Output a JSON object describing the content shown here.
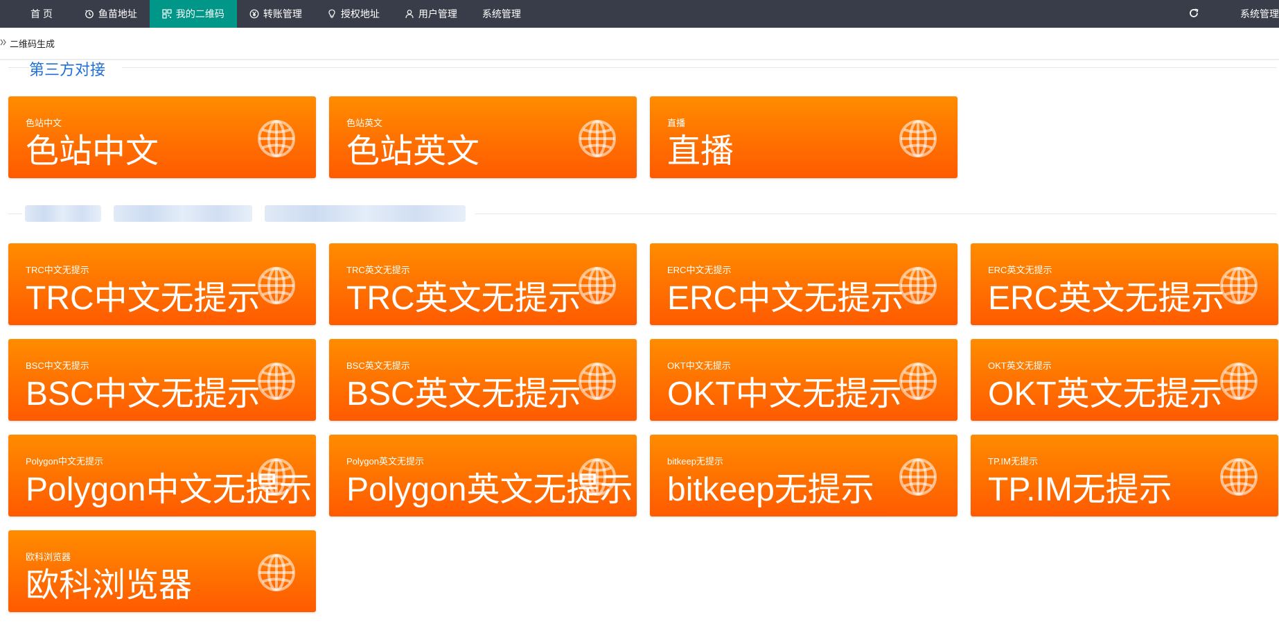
{
  "nav": {
    "items": [
      {
        "label": "首 页",
        "icon": "",
        "active": false
      },
      {
        "label": "鱼苗地址",
        "icon": "timer-icon",
        "active": false
      },
      {
        "label": "我的二维码",
        "icon": "qrcode-icon",
        "active": true
      },
      {
        "label": "转账管理",
        "icon": "yen-icon",
        "active": false
      },
      {
        "label": "授权地址",
        "icon": "bulb-icon",
        "active": false
      },
      {
        "label": "用户管理",
        "icon": "user-icon",
        "active": false
      },
      {
        "label": "系统管理",
        "icon": "",
        "active": false
      }
    ],
    "right_label": "系统管理"
  },
  "tab": {
    "label": "二维码生成"
  },
  "section1": {
    "title": "第三方对接"
  },
  "cards1": [
    {
      "small": "色站中文",
      "big": "色站中文"
    },
    {
      "small": "色站英文",
      "big": "色站英文"
    },
    {
      "small": "直播",
      "big": "直播"
    }
  ],
  "cards2": [
    {
      "small": "TRC中文无提示",
      "big": "TRC中文无提示"
    },
    {
      "small": "TRC英文无提示",
      "big": "TRC英文无提示"
    },
    {
      "small": "ERC中文无提示",
      "big": "ERC中文无提示"
    },
    {
      "small": "ERC英文无提示",
      "big": "ERC英文无提示"
    },
    {
      "small": "BSC中文无提示",
      "big": "BSC中文无提示"
    },
    {
      "small": "BSC英文无提示",
      "big": "BSC英文无提示"
    },
    {
      "small": "OKT中文无提示",
      "big": "OKT中文无提示"
    },
    {
      "small": "OKT英文无提示",
      "big": "OKT英文无提示"
    },
    {
      "small": "Polygon中文无提示",
      "big": "Polygon中文无提示"
    },
    {
      "small": "Polygon英文无提示",
      "big": "Polygon英文无提示"
    },
    {
      "small": "bitkeep无提示",
      "big": "bitkeep无提示"
    },
    {
      "small": "TP.IM无提示",
      "big": "TP.IM无提示"
    },
    {
      "small": "欧科浏览器",
      "big": "欧科浏览器"
    }
  ],
  "colors": {
    "nav_bg": "#393d49",
    "nav_active": "#009688",
    "card_top": "#ff8c00",
    "card_bottom": "#ff5a00",
    "section_title": "#1e6fd9"
  }
}
